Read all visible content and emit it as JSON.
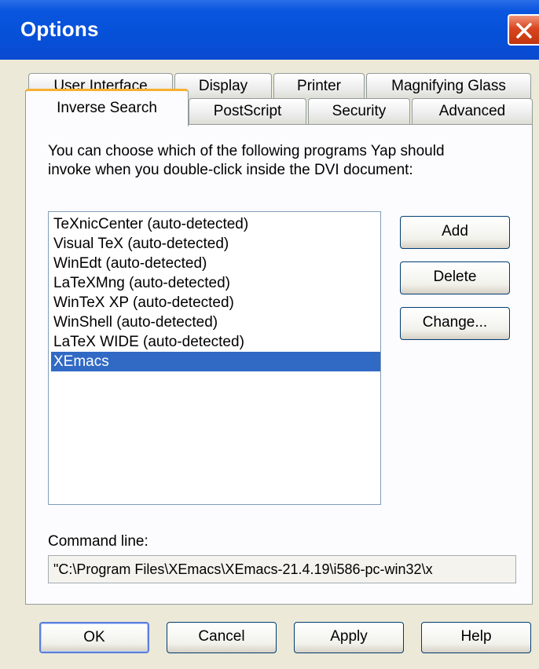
{
  "window": {
    "title": "Options"
  },
  "tabs": {
    "row1": [
      "User Interface",
      "Display",
      "Printer",
      "Magnifying Glass"
    ],
    "row2": [
      "Inverse Search",
      "PostScript",
      "Security",
      "Advanced"
    ],
    "active": "Inverse Search"
  },
  "panel": {
    "intro_line1": "You can choose which of the following programs Yap should",
    "intro_line2": "invoke when you double-click inside the DVI document:",
    "programs": [
      "TeXnicCenter (auto-detected)",
      "Visual TeX (auto-detected)",
      "WinEdt (auto-detected)",
      "LaTeXMng (auto-detected)",
      "WinTeX XP (auto-detected)",
      "WinShell (auto-detected)",
      "LaTeX WIDE (auto-detected)",
      "XEmacs"
    ],
    "selected_program": "XEmacs",
    "add_label": "Add",
    "delete_label": "Delete",
    "change_label": "Change...",
    "command_line_label": "Command line:",
    "command_line_value": "\"C:\\Program Files\\XEmacs\\XEmacs-21.4.19\\i586-pc-win32\\x"
  },
  "buttons": {
    "ok": "OK",
    "cancel": "Cancel",
    "apply": "Apply",
    "help": "Help"
  },
  "colors": {
    "titlebar": "#0a56de",
    "selection": "#316ac5",
    "active_tab_accent": "#f8b030",
    "close_button": "#d9461f"
  }
}
